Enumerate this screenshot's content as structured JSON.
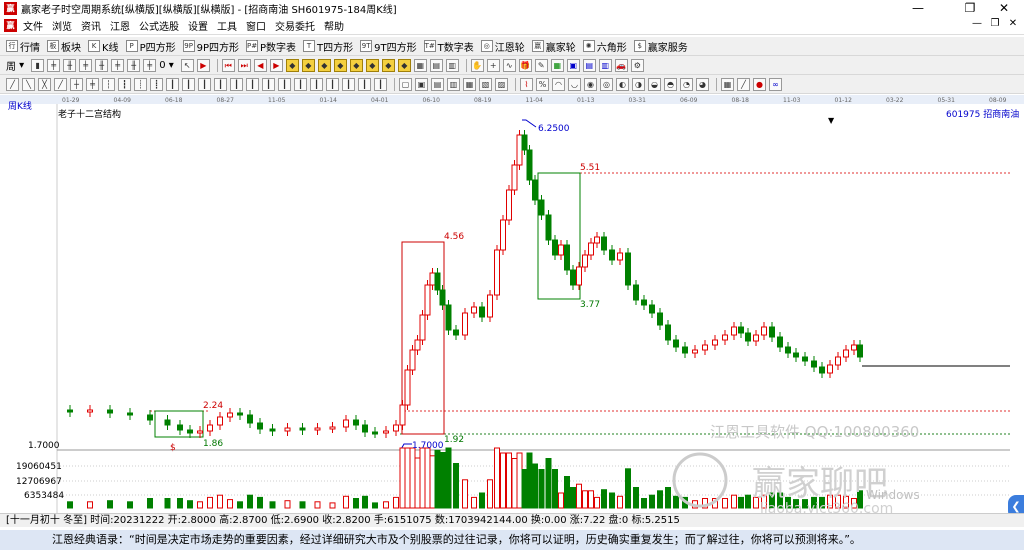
{
  "window": {
    "title": "赢家老子时空周期系统[纵横版][纵横版][纵横版] - [招商南油  SH601975-184周K线]",
    "controls": {
      "minimize": "—",
      "restore": "❐",
      "close": "✕"
    }
  },
  "menu": {
    "items": [
      "文件",
      "浏览",
      "资讯",
      "江恩",
      "公式选股",
      "设置",
      "工具",
      "窗口",
      "交易委托",
      "帮助"
    ],
    "mdi": {
      "minimize": "—",
      "restore": "❐",
      "close": "✕"
    }
  },
  "toolbar1": {
    "items": [
      {
        "icon": "行",
        "label": "行情"
      },
      {
        "icon": "板",
        "label": "板块"
      },
      {
        "icon": "K",
        "label": "K线"
      },
      {
        "icon": "P",
        "label": "P四方形"
      },
      {
        "icon": "9P",
        "label": "9P四方形"
      },
      {
        "icon": "P#",
        "label": "P数字表"
      },
      {
        "icon": "T",
        "label": "T四方形"
      },
      {
        "icon": "9T",
        "label": "9T四方形"
      },
      {
        "icon": "T#",
        "label": "T数字表"
      },
      {
        "icon": "◎",
        "label": "江恩轮"
      },
      {
        "icon": "赢",
        "label": "赢家轮"
      },
      {
        "icon": "✺",
        "label": "六角形"
      },
      {
        "icon": "$",
        "label": "赢家服务"
      }
    ]
  },
  "toolbar2": {
    "first_label": "周",
    "zero_label": "0"
  },
  "chart": {
    "period_label": "周K线",
    "structure_label": "老子十二宫结构",
    "stock_label": "601975 招商南油",
    "dates": [
      "01-29",
      "04-09",
      "06-18",
      "08-27",
      "11-05",
      "01-14",
      "04-01",
      "06-10",
      "08-19",
      "11-04",
      "01-13",
      "03-31",
      "06-09",
      "08-18",
      "11-03",
      "01-12",
      "03-22",
      "05-31",
      "08-09"
    ],
    "price_annotations": {
      "high": "6.2500",
      "p551": "5.51",
      "p456": "4.56",
      "p377": "3.77",
      "p224": "2.24",
      "p186": "1.86",
      "p192": "1.92",
      "low": "1.7000",
      "dollar": "$"
    },
    "left_axis": {
      "price": "1.7000",
      "vol1": "19060451",
      "vol2": "12706967",
      "vol3": "6353484"
    },
    "watermark1": "江恩工具软件  QQ:100800360",
    "watermark2": "赢家聊吧",
    "watermark3": "Windows",
    "watermark4": "liaoba.yict360.com"
  },
  "status": {
    "text": "[十一月初十 冬至] 时间:20231222 开:2.8000 高:2.8700 低:2.6900 收:2.8200 手:6151075 数:1703942144.00 换:0.00 涨:7.22 盘:0 标:5.2515"
  },
  "quote": {
    "text": "江恩经典语录：“时间是决定市场走势的重要因素，经过详细研究大市及个别股票的过往记录，你将可以证明，历史确实重复发生；而了解过往，你将可以预测将来。”。"
  },
  "colors": {
    "up": "#e00000",
    "down": "#008000",
    "box_red": "#cc0000",
    "box_green": "#008000",
    "dash_red": "#e03030",
    "dash_green": "#208020",
    "label_red": "#cc0000",
    "label_blue": "#0000cc",
    "label_green": "#007700"
  }
}
